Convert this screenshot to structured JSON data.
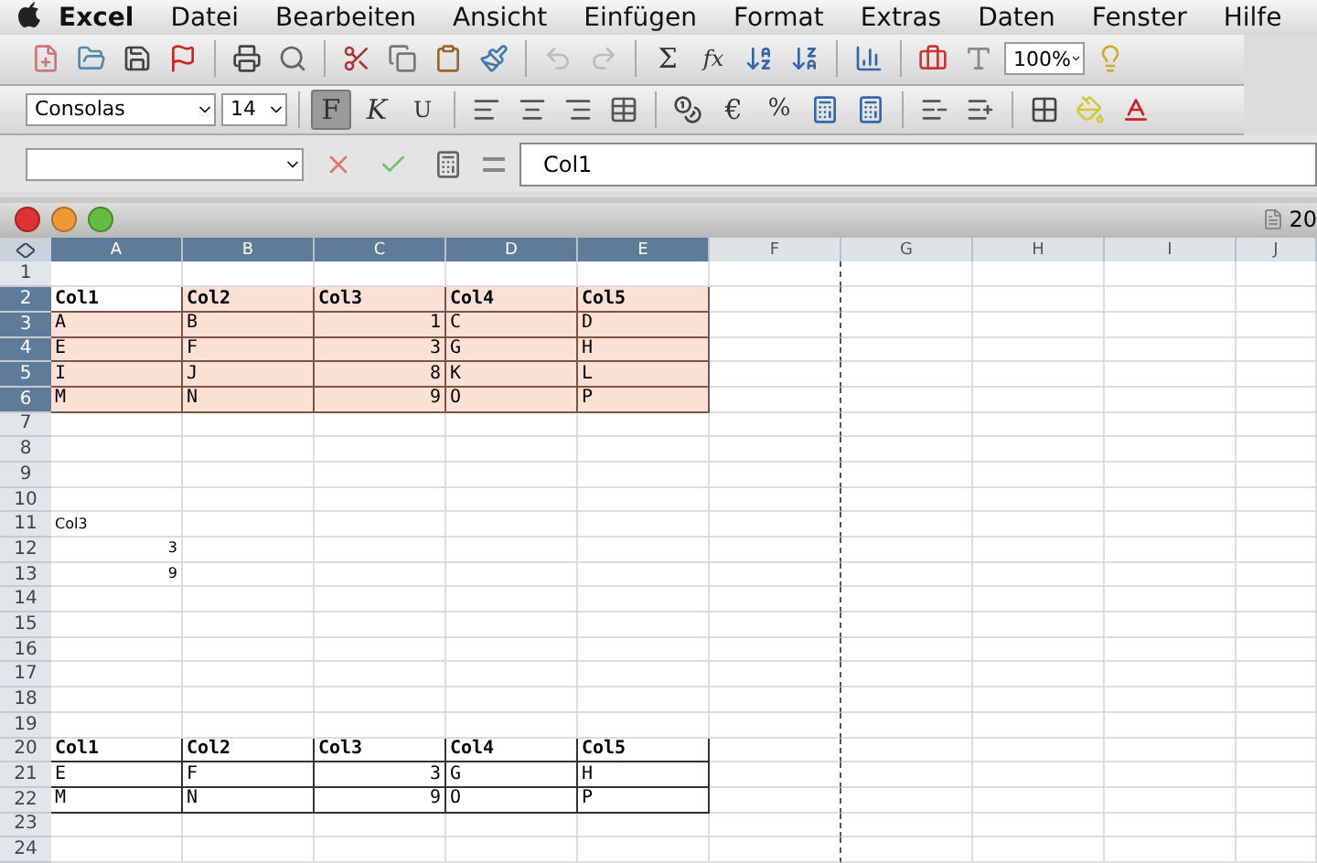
{
  "menu": [
    "Excel",
    "Datei",
    "Bearbeiten",
    "Ansicht",
    "Einfügen",
    "Format",
    "Extras",
    "Daten",
    "Fenster",
    "Hilfe"
  ],
  "toolbar": {
    "sum": "Σ",
    "function": "fx",
    "zoom": "100%"
  },
  "format_bar": {
    "font": "Consolas",
    "size": "14",
    "styles": [
      {
        "label": "F",
        "selected": true
      },
      {
        "label": "K",
        "selected": false
      },
      {
        "label": "U",
        "selected": false
      }
    ],
    "currency": "€",
    "percent": "%"
  },
  "formula_bar": {
    "value": "Col1"
  },
  "window": {
    "title": "20"
  },
  "columns": [
    {
      "label": "A",
      "selected": true
    },
    {
      "label": "B",
      "selected": true
    },
    {
      "label": "C",
      "selected": true
    },
    {
      "label": "D",
      "selected": true
    },
    {
      "label": "E",
      "selected": true
    },
    {
      "label": "F",
      "selected": false
    },
    {
      "label": "G",
      "selected": false
    },
    {
      "label": "H",
      "selected": false
    },
    {
      "label": "I",
      "selected": false
    },
    {
      "label": "J",
      "selected": false
    }
  ],
  "rows": [
    {
      "number": "1",
      "selected": false,
      "kind": "plain",
      "cells": []
    },
    {
      "number": "2",
      "selected": true,
      "kind": "header",
      "highlighted": true,
      "cells": [
        "Col1",
        "Col2",
        "Col3",
        "Col4",
        "Col5"
      ]
    },
    {
      "number": "3",
      "selected": true,
      "kind": "data",
      "highlighted": true,
      "cells": [
        "A",
        "B",
        "1",
        "C",
        "D"
      ]
    },
    {
      "number": "4",
      "selected": true,
      "kind": "data",
      "highlighted": true,
      "cells": [
        "E",
        "F",
        "3",
        "G",
        "H"
      ]
    },
    {
      "number": "5",
      "selected": true,
      "kind": "data",
      "highlighted": true,
      "cells": [
        "I",
        "J",
        "8",
        "K",
        "L"
      ]
    },
    {
      "number": "6",
      "selected": true,
      "kind": "data",
      "highlighted": true,
      "cells": [
        "M",
        "N",
        "9",
        "O",
        "P"
      ]
    },
    {
      "number": "7",
      "selected": false,
      "kind": "plain",
      "cells": []
    },
    {
      "number": "8",
      "selected": false,
      "kind": "plain",
      "cells": []
    },
    {
      "number": "9",
      "selected": false,
      "kind": "plain",
      "cells": []
    },
    {
      "number": "10",
      "selected": false,
      "kind": "plain",
      "cells": []
    },
    {
      "number": "11",
      "selected": false,
      "kind": "plain",
      "cells": [
        "Col3"
      ]
    },
    {
      "number": "12",
      "selected": false,
      "kind": "number",
      "cells": [
        "3"
      ]
    },
    {
      "number": "13",
      "selected": false,
      "kind": "number",
      "cells": [
        "9"
      ]
    },
    {
      "number": "14",
      "selected": false,
      "kind": "plain",
      "cells": []
    },
    {
      "number": "15",
      "selected": false,
      "kind": "plain",
      "cells": []
    },
    {
      "number": "16",
      "selected": false,
      "kind": "plain",
      "cells": []
    },
    {
      "number": "17",
      "selected": false,
      "kind": "plain",
      "cells": []
    },
    {
      "number": "18",
      "selected": false,
      "kind": "plain",
      "cells": []
    },
    {
      "number": "19",
      "selected": false,
      "kind": "plain",
      "cells": []
    },
    {
      "number": "20",
      "selected": false,
      "kind": "header",
      "highlighted": false,
      "cells": [
        "Col1",
        "Col2",
        "Col3",
        "Col4",
        "Col5"
      ]
    },
    {
      "number": "21",
      "selected": false,
      "kind": "data",
      "highlighted": false,
      "cells": [
        "E",
        "F",
        "3",
        "G",
        "H"
      ]
    },
    {
      "number": "22",
      "selected": false,
      "kind": "data",
      "highlighted": false,
      "cells": [
        "M",
        "N",
        "9",
        "O",
        "P"
      ]
    },
    {
      "number": "23",
      "selected": false,
      "kind": "plain",
      "cells": []
    },
    {
      "number": "24",
      "selected": false,
      "kind": "plain",
      "cells": []
    }
  ]
}
